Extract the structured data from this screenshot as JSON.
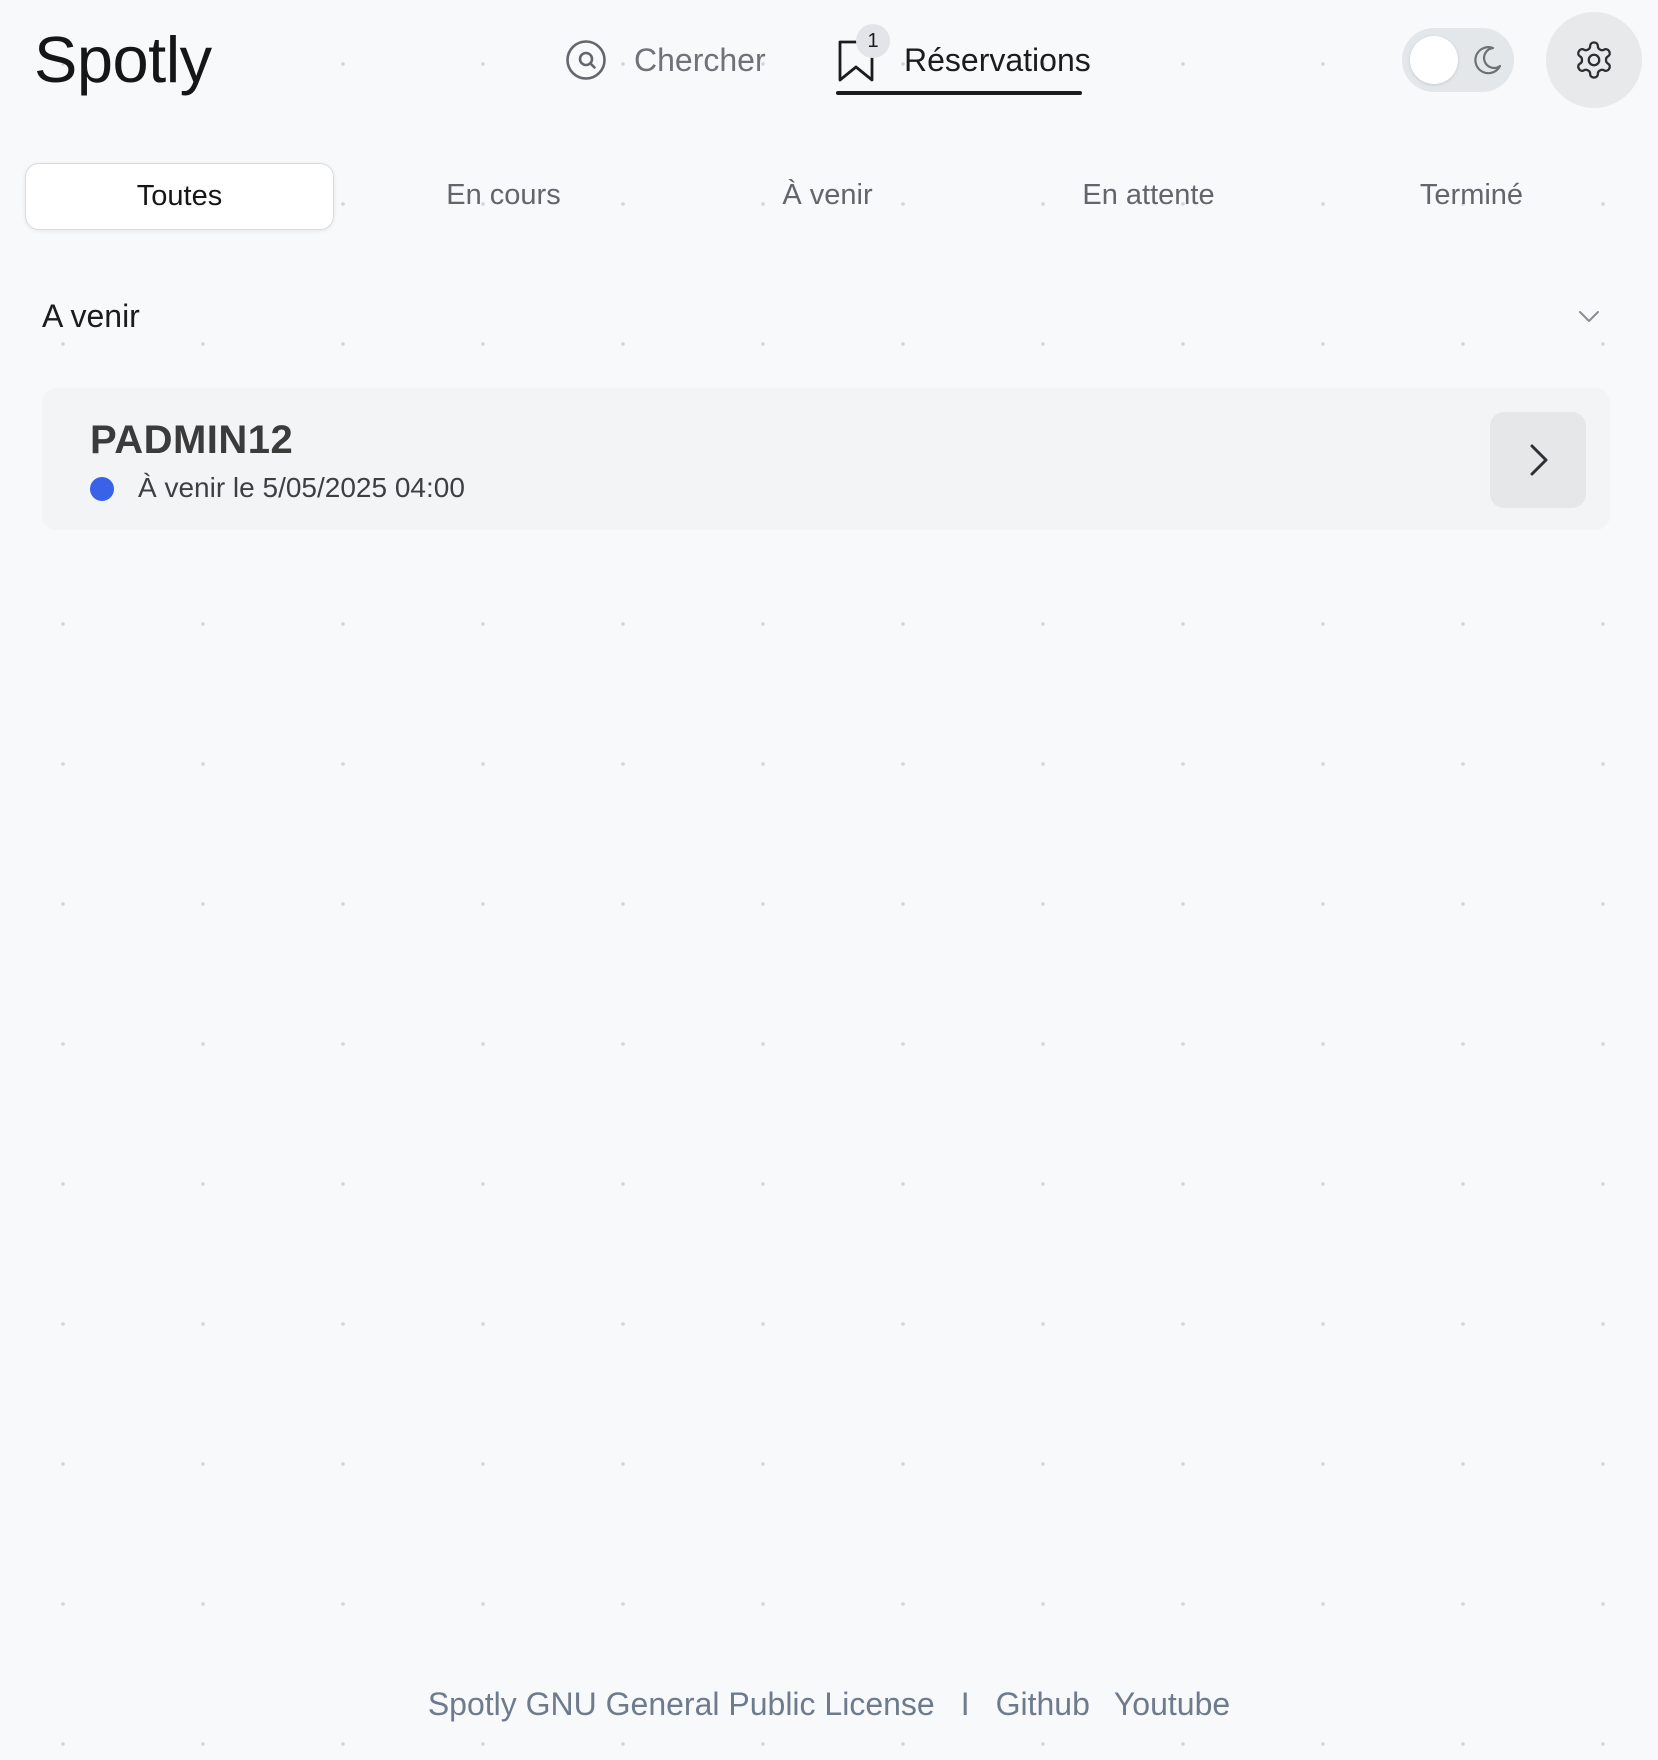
{
  "app": {
    "logo": "Spotly"
  },
  "nav": {
    "search": {
      "label": "Chercher",
      "icon": "at-sign-search-icon"
    },
    "reservations": {
      "label": "Réservations",
      "icon": "bookmark-icon",
      "badge": "1",
      "active": true
    }
  },
  "header": {
    "theme_toggle": {
      "icon": "moon-icon",
      "state": "light"
    },
    "settings_icon": "gear-icon"
  },
  "tabs": [
    {
      "label": "Toutes",
      "active": true
    },
    {
      "label": "En cours"
    },
    {
      "label": "À venir"
    },
    {
      "label": "En attente"
    },
    {
      "label": "Terminé"
    }
  ],
  "section": {
    "title": "A venir",
    "icon": "chevron-down-icon"
  },
  "reservation": {
    "title": "PADMIN12",
    "status": "À venir le 5/05/2025 04:00",
    "status_color": "#3a62e8",
    "action_icon": "chevron-right-icon"
  },
  "footer": {
    "license": "Spotly GNU General Public License",
    "separator": "I",
    "github": "Github",
    "youtube": "Youtube"
  }
}
